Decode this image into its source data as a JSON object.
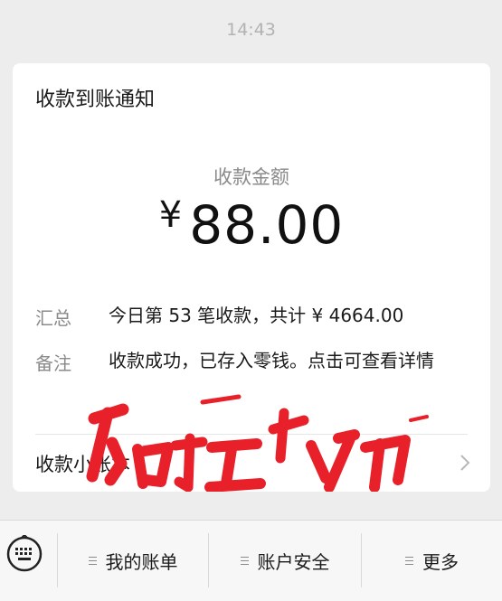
{
  "status": {
    "time": "14:43"
  },
  "notification": {
    "title": "收款到账通知",
    "amount_label": "收款金额",
    "currency": "¥",
    "amount": "88.00",
    "rows": [
      {
        "label": "汇总",
        "value": "今日第 53 笔收款，共计 ¥ 4664.00"
      },
      {
        "label": "备注",
        "value": "收款成功，已存入零钱。点击可查看详情"
      }
    ],
    "footer_link": "收款小账本"
  },
  "bottom_bar": {
    "tabs": [
      {
        "label": "我的账单"
      },
      {
        "label": "账户安全"
      },
      {
        "label": "更多"
      }
    ]
  },
  "colors": {
    "scribble": "#e8202a",
    "background": "#ededed"
  }
}
